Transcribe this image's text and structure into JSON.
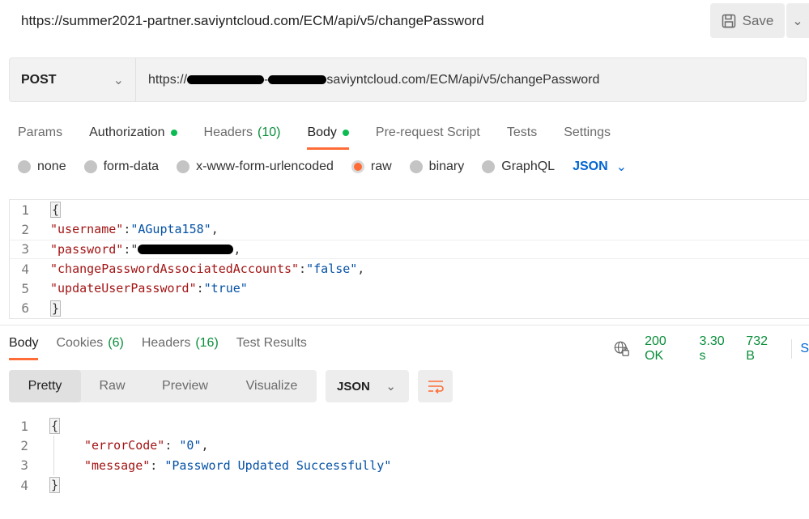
{
  "title": "https://summer2021-partner.saviyntcloud.com/ECM/api/v5/changePassword",
  "save": {
    "label": "Save",
    "icon": "save-icon"
  },
  "request": {
    "method": "POST",
    "url_prefix": "https://",
    "url_suffix": "saviyntcloud.com/ECM/api/v5/changePassword"
  },
  "tabs": [
    {
      "label": "Params"
    },
    {
      "label": "Authorization",
      "dot": true
    },
    {
      "label": "Headers",
      "count": "(10)"
    },
    {
      "label": "Body",
      "dot": true,
      "active": true
    },
    {
      "label": "Pre-request Script"
    },
    {
      "label": "Tests"
    },
    {
      "label": "Settings"
    }
  ],
  "body_types": [
    "none",
    "form-data",
    "x-www-form-urlencoded",
    "raw",
    "binary",
    "GraphQL"
  ],
  "body_type_selected": "raw",
  "body_format": "JSON",
  "request_body": {
    "lines": [
      "1",
      "2",
      "3",
      "4",
      "5",
      "6"
    ],
    "username_key": "\"username\"",
    "username_val": "\"AGupta158\"",
    "password_key": "\"password\"",
    "cpaa_key": "\"changePasswordAssociatedAccounts\"",
    "cpaa_val": "\"false\"",
    "uup_key": "\"updateUserPassword\"",
    "uup_val": "\"true\""
  },
  "response_tabs": [
    {
      "label": "Body",
      "active": true
    },
    {
      "label": "Cookies",
      "count": "(6)"
    },
    {
      "label": "Headers",
      "count": "(16)"
    },
    {
      "label": "Test Results"
    }
  ],
  "status": {
    "code": "200 OK",
    "time": "3.30 s",
    "size": "732 B",
    "cut_label": "S"
  },
  "view_modes": [
    "Pretty",
    "Raw",
    "Preview",
    "Visualize"
  ],
  "response_format": "JSON",
  "response_body": {
    "lines": [
      "1",
      "2",
      "3",
      "4"
    ],
    "error_key": "\"errorCode\"",
    "error_val": "\"0\"",
    "message_key": "\"message\"",
    "message_val": "\"Password Updated Successfully\""
  },
  "colors": {
    "accent": "#ff6c37",
    "success": "#0a8e3b",
    "link": "#0265d2"
  }
}
